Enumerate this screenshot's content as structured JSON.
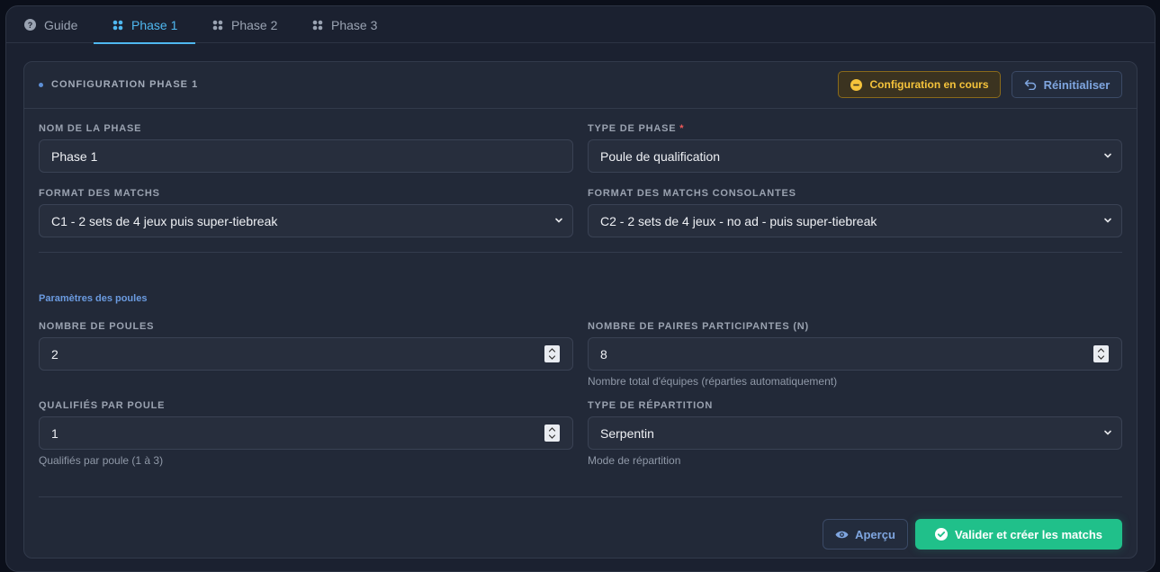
{
  "tabs": [
    {
      "label": "Guide",
      "icon": "help-circle-icon",
      "active": false
    },
    {
      "label": "Phase 1",
      "icon": "grid-dots-icon",
      "active": true
    },
    {
      "label": "Phase 2",
      "icon": "grid-dots-icon",
      "active": false
    },
    {
      "label": "Phase 3",
      "icon": "grid-dots-icon",
      "active": false
    }
  ],
  "card": {
    "title": "CONFIGURATION PHASE 1",
    "status_badge": "Configuration en cours",
    "reset_label": "Réinitialiser"
  },
  "form": {
    "phase_name_label": "NOM DE LA PHASE",
    "phase_name_value": "Phase 1",
    "phase_type_label": "TYPE DE PHASE",
    "phase_type_required": "*",
    "phase_type_value": "Poule de qualification",
    "match_format_label": "FORMAT DES MATCHS",
    "match_format_value": "C1 - 2 sets de 4 jeux puis super-tiebreak",
    "consolante_format_label": "FORMAT DES MATCHS CONSOLANTES",
    "consolante_format_value": "C2 - 2 sets de 4 jeux - no ad - puis super-tiebreak"
  },
  "pools": {
    "section_title": "Paramètres des poules",
    "pool_count_label": "NOMBRE DE POULES",
    "pool_count_value": "2",
    "pairs_label": "NOMBRE DE PAIRES PARTICIPANTES (N)",
    "pairs_value": "8",
    "pairs_hint": "Nombre total d'équipes (réparties automatiquement)",
    "qualified_label": "QUALIFIÉS PAR POULE",
    "qualified_value": "1",
    "qualified_hint": "Qualifiés par poule (1 à 3)",
    "distribution_label": "TYPE DE RÉPARTITION",
    "distribution_value": "Serpentin",
    "distribution_hint": "Mode de répartition"
  },
  "actions": {
    "preview_label": "Aperçu",
    "validate_label": "Valider et créer les matchs"
  },
  "colors": {
    "accent": "#4fb8f0",
    "success": "#20c08a",
    "warning": "#f5c33b",
    "link": "#7fa6e0"
  }
}
